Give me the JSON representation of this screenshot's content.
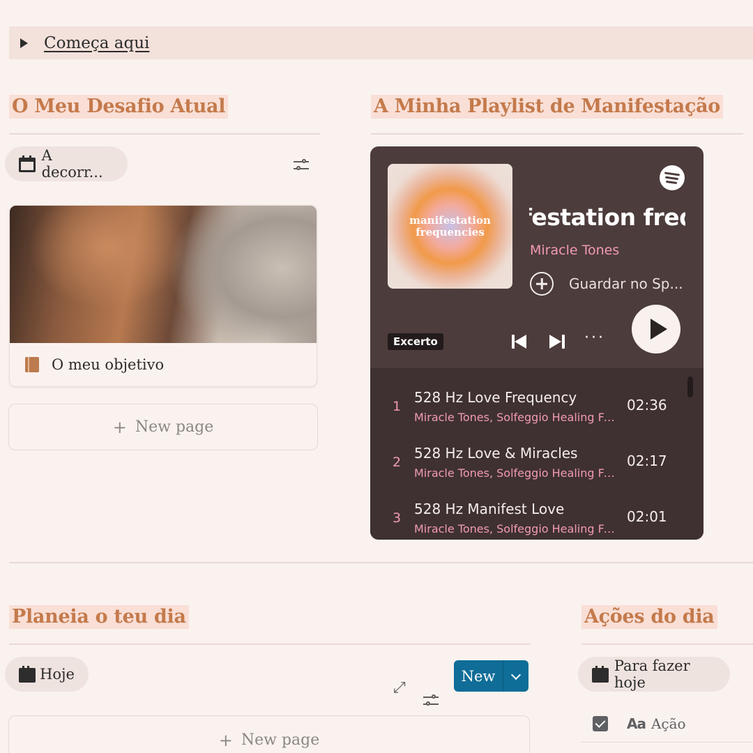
{
  "toggle": {
    "label": "Começa aqui"
  },
  "challenge": {
    "heading": "O Meu Desafio Atual",
    "filter_label": "A decorr...",
    "card_title": "O meu objetivo",
    "new_page": "New page"
  },
  "playlist": {
    "heading": "A Minha Playlist de Manifestação",
    "cover_text_line1": "manifestation",
    "cover_text_line2": "frequencies",
    "title": "manifestation frequencies",
    "artist": "Miracle Tones",
    "save_label": "Guardar no Sp...",
    "badge": "Excerto",
    "more_label": "···",
    "tracks": [
      {
        "num": "1",
        "name": "528 Hz Love Frequency",
        "artists": "Miracle Tones, Solfeggio Healing Fr...",
        "duration": "02:36"
      },
      {
        "num": "2",
        "name": "528 Hz Love & Miracles",
        "artists": "Miracle Tones, Solfeggio Healing Fr...",
        "duration": "02:17"
      },
      {
        "num": "3",
        "name": "528 Hz Manifest Love",
        "artists": "Miracle Tones, Solfeggio Healing Fr...",
        "duration": "02:01"
      }
    ]
  },
  "plan": {
    "heading": "Planeia o teu dia",
    "filter_label": "Hoje",
    "new_button": "New",
    "new_page": "New page"
  },
  "actions": {
    "heading": "Ações do dia",
    "filter_label": "Para fazer hoje",
    "column_label": "Ação",
    "aa_label": "Aa"
  },
  "colors": {
    "background": "#faf2ef",
    "heading": "#c47a4c",
    "heading_highlight": "#f9dfd6",
    "spotify_bg": "#4c3c3b",
    "spotify_pink": "#f19ab4",
    "new_button": "#0f6d97"
  }
}
